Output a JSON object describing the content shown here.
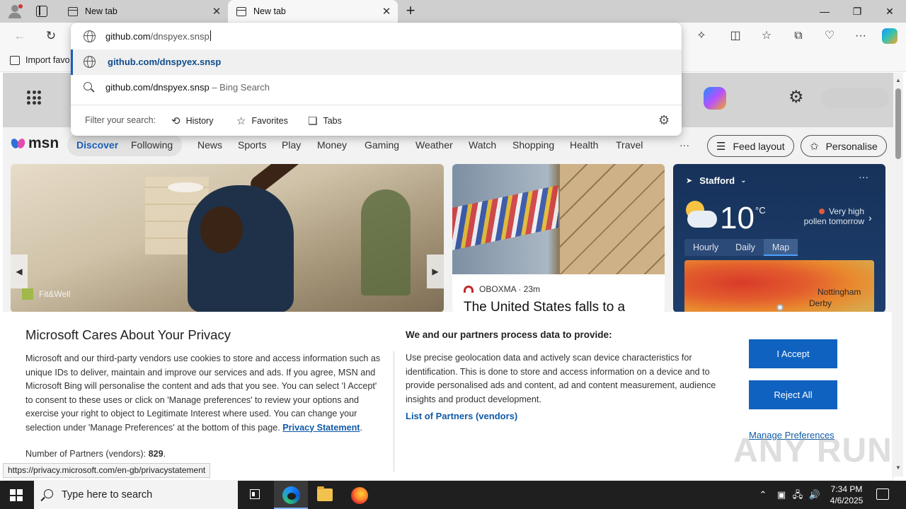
{
  "browser": {
    "tabs": [
      {
        "title": "New tab",
        "active": false
      },
      {
        "title": "New tab",
        "active": true
      }
    ],
    "address": {
      "typed_host": "github.com",
      "typed_path": "/dnspyex.snsp"
    },
    "suggestions": [
      {
        "text": "github.com/dnspyex.snsp",
        "type": "url",
        "selected": true
      },
      {
        "text": "github.com/dnspyex.snsp",
        "suffix": "– Bing Search",
        "type": "search",
        "selected": false
      }
    ],
    "filter": {
      "label": "Filter your search:",
      "options": [
        {
          "label": "History",
          "icon": "history-icon"
        },
        {
          "label": "Favorites",
          "icon": "star-icon"
        },
        {
          "label": "Tabs",
          "icon": "tabs-icon"
        }
      ]
    },
    "favorites_bar": {
      "import_label": "Import favo"
    },
    "accent_color": "#1b5fb6"
  },
  "msn": {
    "logo_text": "msn",
    "nav": [
      "Discover",
      "Following",
      "News",
      "Sports",
      "Play",
      "Money",
      "Gaming",
      "Weather",
      "Watch",
      "Shopping",
      "Health",
      "Travel"
    ],
    "more": "···",
    "feed_layout": "Feed layout",
    "personalise": "Personalise",
    "hero_source": "Fit&Well",
    "news_card": {
      "publisher": "OBOXMA · 23m",
      "headline": "The United States falls to a"
    },
    "weather": {
      "location": "Stafford",
      "temperature": "10",
      "unit": "°C",
      "pollen_line1": "Very high",
      "pollen_line2": "pollen tomorrow",
      "tabs": [
        "Hourly",
        "Daily",
        "Map"
      ],
      "selected_tab": "Map",
      "map_labels": [
        "Nottingham",
        "Derby"
      ]
    }
  },
  "privacy": {
    "title": "Microsoft Cares About Your Privacy",
    "body": "Microsoft and our third-party vendors use cookies to store and access information such as unique IDs to deliver, maintain and improve our services and ads. If you agree, MSN and Microsoft Bing will personalise the content and ads that you see. You can select 'I Accept' to consent to these uses or click on 'Manage preferences' to review your options and exercise your right to object to Legitimate Interest where used. You can change your selection under 'Manage Preferences' at the bottom of this page.",
    "privacy_link": "Privacy Statement",
    "partners_count_label": "Number of Partners (vendors):",
    "partners_count": "829",
    "right_heading": "We and our partners process data to provide:",
    "right_body": "Use precise geolocation data and actively scan device characteristics for identification. This is done to store and access information on a device and to provide personalised ads and content, ad and content measurement, audience insights and product development.",
    "partners_link": "List of Partners (vendors)",
    "accept": "I Accept",
    "reject": "Reject All",
    "manage": "Manage Preferences"
  },
  "status_url": "https://privacy.microsoft.com/en-gb/privacystatement",
  "watermark": "ANY RUN",
  "taskbar": {
    "search_placeholder": "Type here to search",
    "time": "7:34 PM",
    "date": "4/6/2025"
  }
}
